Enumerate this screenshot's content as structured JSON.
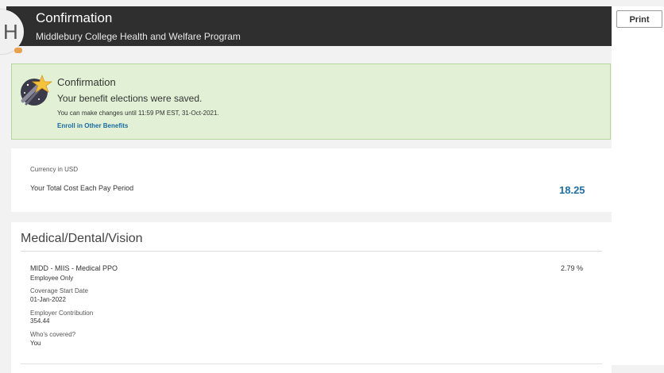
{
  "header": {
    "title": "Confirmation",
    "subtitle": "Middlebury College Health and Welfare Program",
    "avatar_initial": "H"
  },
  "toolbar": {
    "print_label": "Print"
  },
  "confirmation": {
    "title": "Confirmation",
    "message": "Your benefit elections were saved.",
    "note": "You can make changes until 11:59 PM EST, 31-Oct-2021.",
    "link": "Enroll in Other Benefits",
    "icon": "shooting-star-icon"
  },
  "cost": {
    "currency": "Currency in USD",
    "label": "Your Total Cost Each Pay Period",
    "value": "18.25"
  },
  "medical": {
    "section_title": "Medical/Dental/Vision",
    "plan_name": "MIDD - MIIS - Medical PPO",
    "plan_percent": "2.79 %",
    "coverage_level": "Employee Only",
    "coverage_start_label": "Coverage Start Date",
    "coverage_start_value": "01-Jan-2022",
    "employer_contribution_label": "Employer Contribution",
    "employer_contribution_value": "354.44",
    "covered_label": "Who's covered?",
    "covered_value": "You"
  },
  "colors": {
    "header_bg": "#2f2f2f",
    "success_bg": "#e2f1d5",
    "link": "#1a6aa0",
    "cost_value": "#1f6fa5"
  }
}
